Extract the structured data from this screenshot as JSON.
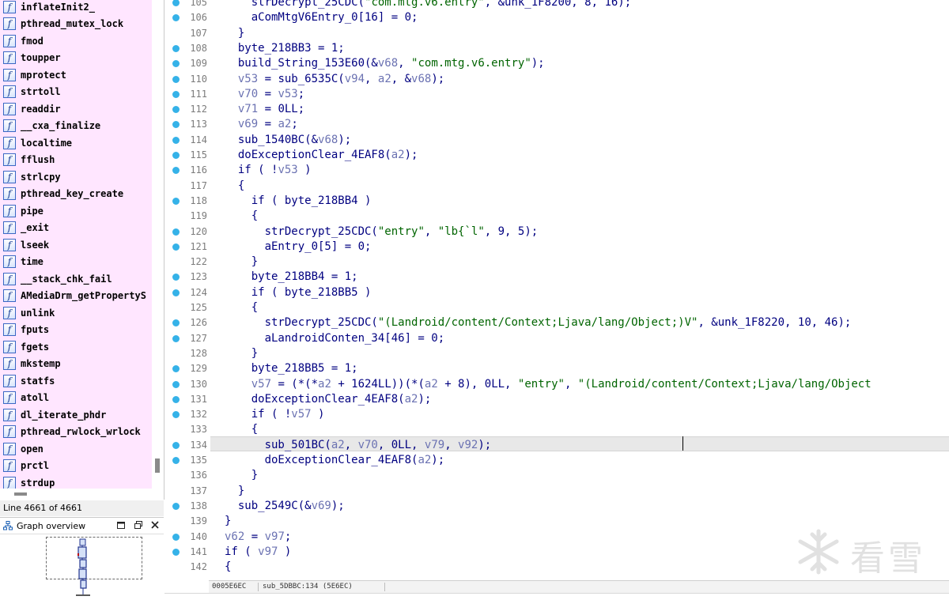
{
  "functions_panel": {
    "items": [
      "inflateInit2_",
      "pthread_mutex_lock",
      "fmod",
      "toupper",
      "mprotect",
      "strtoll",
      "readdir",
      "__cxa_finalize",
      "localtime",
      "fflush",
      "strlcpy",
      "pthread_key_create",
      "pipe",
      "_exit",
      "lseek",
      "time",
      "__stack_chk_fail",
      "AMediaDrm_getPropertyS",
      "unlink",
      "fputs",
      "fgets",
      "mkstemp",
      "statfs",
      "atoll",
      "dl_iterate_phdr",
      "pthread_rwlock_wrlock",
      "open",
      "prctl",
      "strdup"
    ],
    "status": "Line 4661 of 4661",
    "colors": {
      "list_background": "#ffe6ff",
      "icon_border": "#3a67c4"
    },
    "icon": "function-icon"
  },
  "graph_overview": {
    "title": "Graph overview",
    "buttons": [
      "restore-icon",
      "float-icon",
      "close-icon"
    ]
  },
  "code": {
    "current_line": 134,
    "colors": {
      "keyword": "#000080",
      "variable": "#6b72b2",
      "string": "#006400",
      "breakpoint": "#35b2e8",
      "highlight": "#e8e8e8"
    },
    "lines": [
      {
        "n": "105",
        "dot": true,
        "segs": [
          [
            "p",
            "    strDecrypt_25CDC("
          ],
          [
            "s",
            "\"com.mtg.v6.entry\""
          ],
          [
            "p",
            ", &unk_1F8200, 8, 16);"
          ]
        ]
      },
      {
        "n": "106",
        "dot": true,
        "segs": [
          [
            "p",
            "    aComMtgV6Entry_0[16] = 0;"
          ]
        ]
      },
      {
        "n": "107",
        "dot": false,
        "segs": [
          [
            "p",
            "  }"
          ]
        ]
      },
      {
        "n": "108",
        "dot": true,
        "segs": [
          [
            "p",
            "  byte_218BB3 = 1;"
          ]
        ]
      },
      {
        "n": "109",
        "dot": true,
        "segs": [
          [
            "p",
            "  build_String_153E60(&"
          ],
          [
            "v",
            "v68"
          ],
          [
            "p",
            ", "
          ],
          [
            "s",
            "\"com.mtg.v6.entry\""
          ],
          [
            "p",
            ");"
          ]
        ]
      },
      {
        "n": "110",
        "dot": true,
        "segs": [
          [
            "p",
            "  "
          ],
          [
            "v",
            "v53"
          ],
          [
            "p",
            " = sub_6535C("
          ],
          [
            "v",
            "v94"
          ],
          [
            "p",
            ", "
          ],
          [
            "v",
            "a2"
          ],
          [
            "p",
            ", &"
          ],
          [
            "v",
            "v68"
          ],
          [
            "p",
            ");"
          ]
        ]
      },
      {
        "n": "111",
        "dot": true,
        "segs": [
          [
            "p",
            "  "
          ],
          [
            "v",
            "v70"
          ],
          [
            "p",
            " = "
          ],
          [
            "v",
            "v53"
          ],
          [
            "p",
            ";"
          ]
        ]
      },
      {
        "n": "112",
        "dot": true,
        "segs": [
          [
            "p",
            "  "
          ],
          [
            "v",
            "v71"
          ],
          [
            "p",
            " = 0LL;"
          ]
        ]
      },
      {
        "n": "113",
        "dot": true,
        "segs": [
          [
            "p",
            "  "
          ],
          [
            "v",
            "v69"
          ],
          [
            "p",
            " = "
          ],
          [
            "v",
            "a2"
          ],
          [
            "p",
            ";"
          ]
        ]
      },
      {
        "n": "114",
        "dot": true,
        "segs": [
          [
            "p",
            "  sub_1540BC(&"
          ],
          [
            "v",
            "v68"
          ],
          [
            "p",
            ");"
          ]
        ]
      },
      {
        "n": "115",
        "dot": true,
        "segs": [
          [
            "p",
            "  doExceptionClear_4EAF8("
          ],
          [
            "v",
            "a2"
          ],
          [
            "p",
            ");"
          ]
        ]
      },
      {
        "n": "116",
        "dot": true,
        "segs": [
          [
            "p",
            "  if ( !"
          ],
          [
            "v",
            "v53"
          ],
          [
            "p",
            " )"
          ]
        ]
      },
      {
        "n": "117",
        "dot": false,
        "segs": [
          [
            "p",
            "  {"
          ]
        ]
      },
      {
        "n": "118",
        "dot": true,
        "segs": [
          [
            "p",
            "    if ( byte_218BB4 )"
          ]
        ]
      },
      {
        "n": "119",
        "dot": false,
        "segs": [
          [
            "p",
            "    {"
          ]
        ]
      },
      {
        "n": "120",
        "dot": true,
        "segs": [
          [
            "p",
            "      strDecrypt_25CDC("
          ],
          [
            "s",
            "\"entry\""
          ],
          [
            "p",
            ", "
          ],
          [
            "s",
            "\"lb{`l\""
          ],
          [
            "p",
            ", 9, 5);"
          ]
        ]
      },
      {
        "n": "121",
        "dot": true,
        "segs": [
          [
            "p",
            "      aEntry_0[5] = 0;"
          ]
        ]
      },
      {
        "n": "122",
        "dot": false,
        "segs": [
          [
            "p",
            "    }"
          ]
        ]
      },
      {
        "n": "123",
        "dot": true,
        "segs": [
          [
            "p",
            "    byte_218BB4 = 1;"
          ]
        ]
      },
      {
        "n": "124",
        "dot": true,
        "segs": [
          [
            "p",
            "    if ( byte_218BB5 )"
          ]
        ]
      },
      {
        "n": "125",
        "dot": false,
        "segs": [
          [
            "p",
            "    {"
          ]
        ]
      },
      {
        "n": "126",
        "dot": true,
        "segs": [
          [
            "p",
            "      strDecrypt_25CDC("
          ],
          [
            "s",
            "\"(Landroid/content/Context;Ljava/lang/Object;)V\""
          ],
          [
            "p",
            ", &unk_1F8220, 10, 46);"
          ]
        ]
      },
      {
        "n": "127",
        "dot": true,
        "segs": [
          [
            "p",
            "      aLandroidConten_34[46] = 0;"
          ]
        ]
      },
      {
        "n": "128",
        "dot": false,
        "segs": [
          [
            "p",
            "    }"
          ]
        ]
      },
      {
        "n": "129",
        "dot": true,
        "segs": [
          [
            "p",
            "    byte_218BB5 = 1;"
          ]
        ]
      },
      {
        "n": "130",
        "dot": true,
        "segs": [
          [
            "p",
            "    "
          ],
          [
            "v",
            "v57"
          ],
          [
            "p",
            " = (*(*"
          ],
          [
            "v",
            "a2"
          ],
          [
            "p",
            " + 1624LL))(*("
          ],
          [
            "v",
            "a2"
          ],
          [
            "p",
            " + 8), 0LL, "
          ],
          [
            "s",
            "\"entry\""
          ],
          [
            "p",
            ", "
          ],
          [
            "s",
            "\"(Landroid/content/Context;Ljava/lang/Object"
          ]
        ]
      },
      {
        "n": "131",
        "dot": true,
        "segs": [
          [
            "p",
            "    doExceptionClear_4EAF8("
          ],
          [
            "v",
            "a2"
          ],
          [
            "p",
            ");"
          ]
        ]
      },
      {
        "n": "132",
        "dot": true,
        "segs": [
          [
            "p",
            "    if ( !"
          ],
          [
            "v",
            "v57"
          ],
          [
            "p",
            " )"
          ]
        ]
      },
      {
        "n": "133",
        "dot": false,
        "segs": [
          [
            "p",
            "    {"
          ]
        ]
      },
      {
        "n": "134",
        "dot": true,
        "segs": [
          [
            "p",
            "      sub_501BC("
          ],
          [
            "v",
            "a2"
          ],
          [
            "p",
            ", "
          ],
          [
            "v",
            "v70"
          ],
          [
            "p",
            ", 0LL, "
          ],
          [
            "v",
            "v79"
          ],
          [
            "p",
            ", "
          ],
          [
            "v",
            "v92"
          ],
          [
            "p",
            ");"
          ]
        ]
      },
      {
        "n": "135",
        "dot": true,
        "segs": [
          [
            "p",
            "      doExceptionClear_4EAF8("
          ],
          [
            "v",
            "a2"
          ],
          [
            "p",
            ");"
          ]
        ]
      },
      {
        "n": "136",
        "dot": false,
        "segs": [
          [
            "p",
            "    }"
          ]
        ]
      },
      {
        "n": "137",
        "dot": false,
        "segs": [
          [
            "p",
            "  }"
          ]
        ]
      },
      {
        "n": "138",
        "dot": true,
        "segs": [
          [
            "p",
            "  sub_2549C(&"
          ],
          [
            "v",
            "v69"
          ],
          [
            "p",
            ");"
          ]
        ]
      },
      {
        "n": "139",
        "dot": false,
        "segs": [
          [
            "p",
            "}"
          ]
        ]
      },
      {
        "n": "140",
        "dot": true,
        "segs": [
          [
            "v",
            "v62"
          ],
          [
            "p",
            " = "
          ],
          [
            "v",
            "v97"
          ],
          [
            "p",
            ";"
          ]
        ]
      },
      {
        "n": "141",
        "dot": true,
        "segs": [
          [
            "p",
            "if ( "
          ],
          [
            "v",
            "v97"
          ],
          [
            "p",
            " )"
          ]
        ]
      },
      {
        "n": "142",
        "dot": false,
        "segs": [
          [
            "p",
            "{"
          ]
        ]
      }
    ]
  },
  "code_status": {
    "address": "0005E6EC",
    "location": "sub_5DBBC:134 (5E6EC)"
  },
  "watermark": {
    "text": "看雪",
    "icon": "snowflake-icon"
  }
}
